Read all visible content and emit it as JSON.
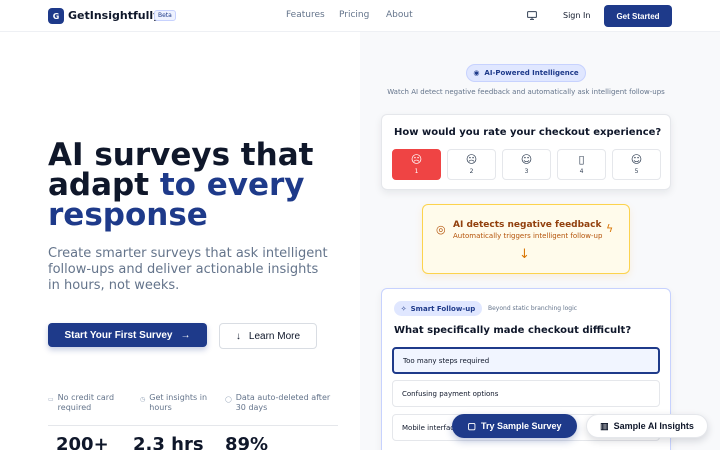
{
  "header": {
    "logo_letter": "G",
    "brand": "GetInsightfully",
    "badge": "Beta",
    "nav": [
      "Features",
      "Pricing",
      "About"
    ],
    "monitor_icon": "monitor-icon",
    "sign_in": "Sign In",
    "get_started": "Get Started"
  },
  "hero": {
    "title_line1": "AI surveys that",
    "title_line2a": "adapt ",
    "title_line2b": "to every",
    "title_line3": "response",
    "subtitle": "Create smarter surveys that ask intelligent follow-ups and deliver actionable insights in hours, not weeks.",
    "primary_cta": "Start Your First Survey",
    "primary_cta_icon": "→",
    "secondary_cta": "Learn More",
    "secondary_cta_icon": "↓",
    "features": [
      {
        "icon": "▭",
        "text": "No credit card required"
      },
      {
        "icon": "◷",
        "text": "Get insights in hours"
      },
      {
        "icon": "◯",
        "text": "Data auto-deleted after 30 days"
      }
    ],
    "stats": [
      "200+",
      "2.3 hrs",
      "89%"
    ]
  },
  "demo": {
    "pill": "AI-Powered Intelligence",
    "pill_icon": "◉",
    "description": "Watch AI detect negative feedback and automatically ask intelligent follow-ups",
    "rating": {
      "question": "How would you rate your checkout experience?",
      "options": [
        {
          "face": "☹",
          "num": "1"
        },
        {
          "face": "☹",
          "num": "2"
        },
        {
          "face": "☺",
          "num": "3"
        },
        {
          "face": "▯",
          "num": "4"
        },
        {
          "face": "☺",
          "num": "5"
        }
      ],
      "selected": 1
    },
    "detect": {
      "icon": "◎",
      "title": "AI detects negative feedback",
      "subtitle": "Automatically triggers intelligent follow-up",
      "bolt": "ϟ",
      "arrow": "↓"
    },
    "followup": {
      "pill": "Smart Follow-up",
      "pill_icon": "✧",
      "note": "Beyond static branching logic",
      "question": "What specifically made checkout difficult?",
      "options": [
        "Too many steps required",
        "Confusing payment options",
        "Mobile interface issues"
      ]
    }
  },
  "floating": {
    "try": "Try Sample Survey",
    "try_icon": "▢",
    "insights": "Sample AI Insights",
    "insights_icon": "▥"
  },
  "colors": {
    "brand": "#1e3a8a",
    "danger": "#ef4444",
    "warning_bg": "#fffbeb",
    "warning_border": "#fcd34d"
  }
}
